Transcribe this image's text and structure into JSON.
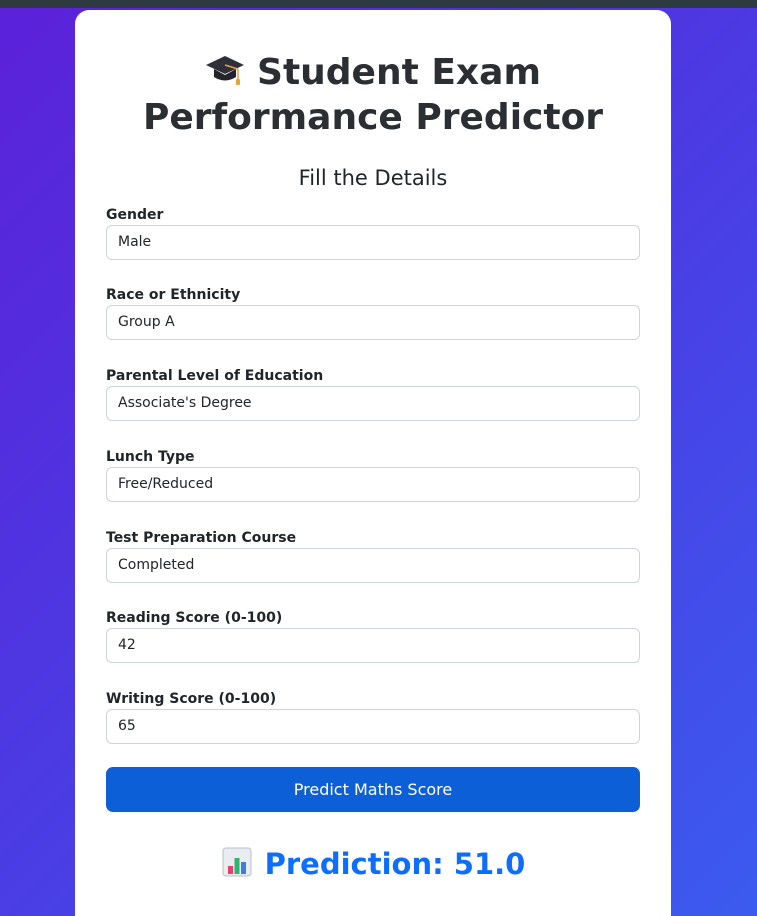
{
  "header": {
    "title_line1": "Student Exam",
    "title_line2": "Performance Predictor",
    "subtitle": "Fill the Details"
  },
  "form": {
    "gender": {
      "label": "Gender",
      "value": "Male"
    },
    "race": {
      "label": "Race or Ethnicity",
      "value": "Group A"
    },
    "parental_education": {
      "label": "Parental Level of Education",
      "value": "Associate's Degree"
    },
    "lunch": {
      "label": "Lunch Type",
      "value": "Free/Reduced"
    },
    "test_prep": {
      "label": "Test Preparation Course",
      "value": "Completed"
    },
    "reading": {
      "label": "Reading Score (0-100)",
      "value": "42"
    },
    "writing": {
      "label": "Writing Score (0-100)",
      "value": "65"
    },
    "submit_label": "Predict Maths Score"
  },
  "result": {
    "text": "Prediction: 51.0"
  },
  "icons": {
    "title_icon": "graduation-cap-icon",
    "result_icon": "bar-chart-icon"
  },
  "colors": {
    "accent": "#0d6efd",
    "button": "#0d5fd8"
  }
}
